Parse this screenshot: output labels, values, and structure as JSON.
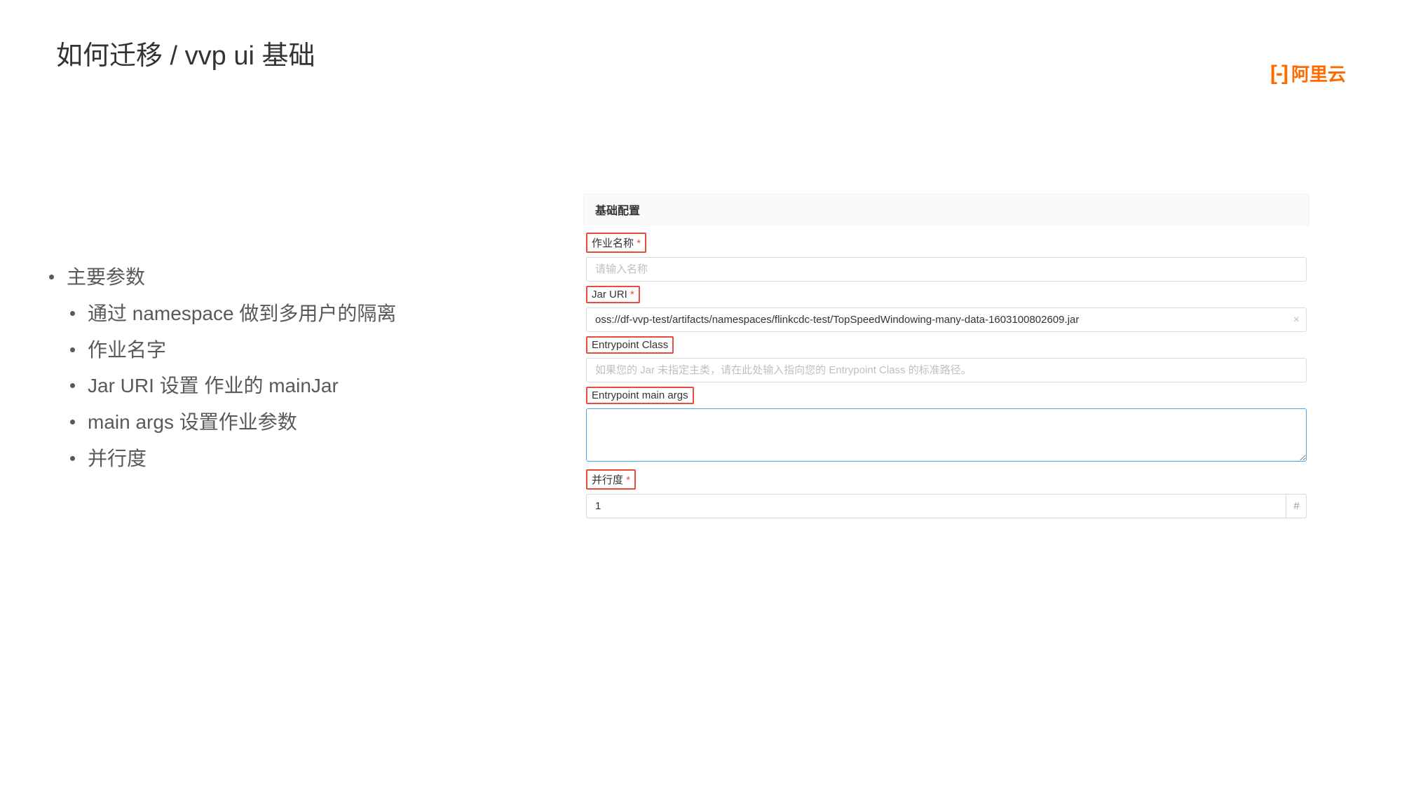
{
  "title": "如何迁移 / vvp ui 基础",
  "logo": {
    "brackets": "[-]",
    "text": "阿里云"
  },
  "left": {
    "heading": "主要参数",
    "bullets": [
      "通过 namespace 做到多用户的隔离",
      "作业名字",
      "Jar URI 设置 作业的 mainJar",
      "main args 设置作业参数",
      "并行度"
    ]
  },
  "form": {
    "panelTitle": "基础配置",
    "jobName": {
      "label": "作业名称",
      "star": "*",
      "placeholder": "请输入名称"
    },
    "jarUri": {
      "label": "Jar URI",
      "star": "*",
      "value": "oss://df-vvp-test/artifacts/namespaces/flinkcdc-test/TopSpeedWindowing-many-data-1603100802609.jar",
      "clear": "×"
    },
    "entryClass": {
      "label": "Entrypoint Class",
      "placeholder": "如果您的 Jar 未指定主类，请在此处输入指向您的 Entrypoint Class 的标准路径。"
    },
    "mainArgs": {
      "label": "Entrypoint main args"
    },
    "parallelism": {
      "label": "并行度",
      "star": "*",
      "value": "1",
      "hash": "#"
    }
  }
}
